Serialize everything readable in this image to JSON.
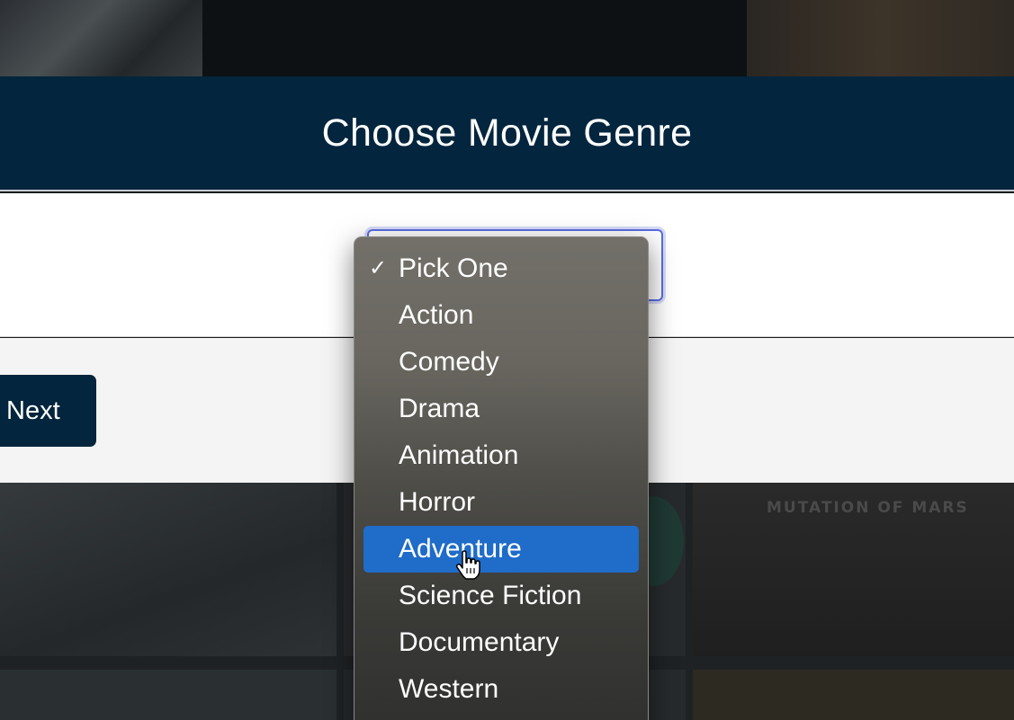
{
  "header": {
    "title": "Choose Movie Genre"
  },
  "genre_select": {
    "selected": "Pick One",
    "highlighted": "Adventure",
    "options": [
      "Pick One",
      "Action",
      "Comedy",
      "Drama",
      "Animation",
      "Horror",
      "Adventure",
      "Science Fiction",
      "Documentary",
      "Western"
    ]
  },
  "footer": {
    "next_label": "Next"
  },
  "lower_posters": {
    "caption": "MUTATION OF MARS"
  },
  "colors": {
    "header_bg": "#03253d",
    "highlight": "#1f6cc9",
    "focus_ring": "#5b6ee0"
  },
  "icons": {
    "check": "checkmark-icon",
    "cursor": "hand-pointer-icon"
  }
}
